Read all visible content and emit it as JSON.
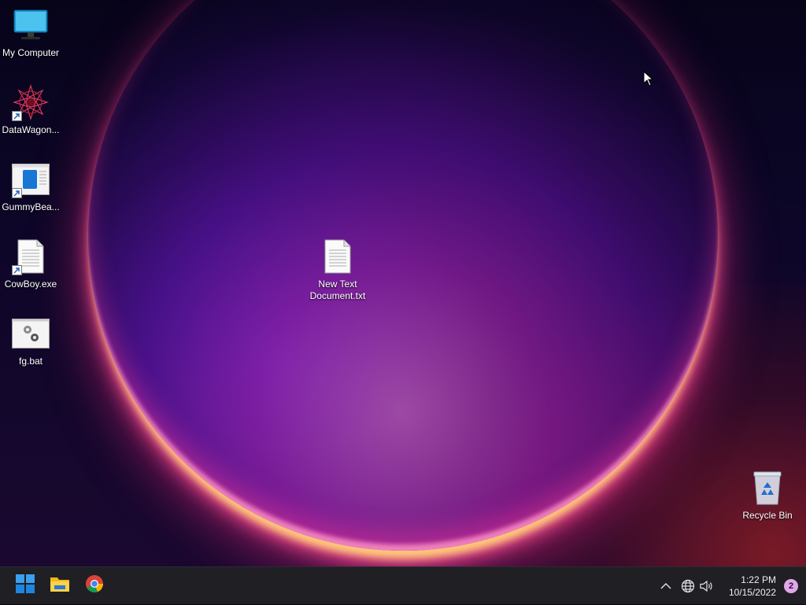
{
  "desktop": {
    "icons": [
      {
        "label": "My Computer",
        "icon": "monitor-icon"
      },
      {
        "label": "DataWagon...",
        "icon": "mandala-icon",
        "shortcut": true
      },
      {
        "label": "GummyBea...",
        "icon": "window-app-icon",
        "shortcut": true
      },
      {
        "label": "CowBoy.exe",
        "icon": "document-icon",
        "shortcut": true
      },
      {
        "label": "fg.bat",
        "icon": "gears-window-icon"
      },
      {
        "label": "New Text Document.txt",
        "icon": "text-document-icon"
      },
      {
        "label": "Recycle Bin",
        "icon": "recycle-bin-icon"
      }
    ]
  },
  "taskbar": {
    "pinned": [
      {
        "name": "Start",
        "icon": "windows-start-icon"
      },
      {
        "name": "File Explorer",
        "icon": "folder-icon"
      },
      {
        "name": "Google Chrome",
        "icon": "chrome-icon"
      }
    ],
    "tray": {
      "icons": [
        "chevron-up-icon",
        "globe-icon",
        "speaker-icon"
      ],
      "time": "1:22 PM",
      "date": "10/15/2022",
      "notification_count": "2"
    }
  },
  "colors": {
    "taskbar_bg": "#1f1f24",
    "accent": "#0078d4",
    "badge": "#e0a8e8"
  }
}
